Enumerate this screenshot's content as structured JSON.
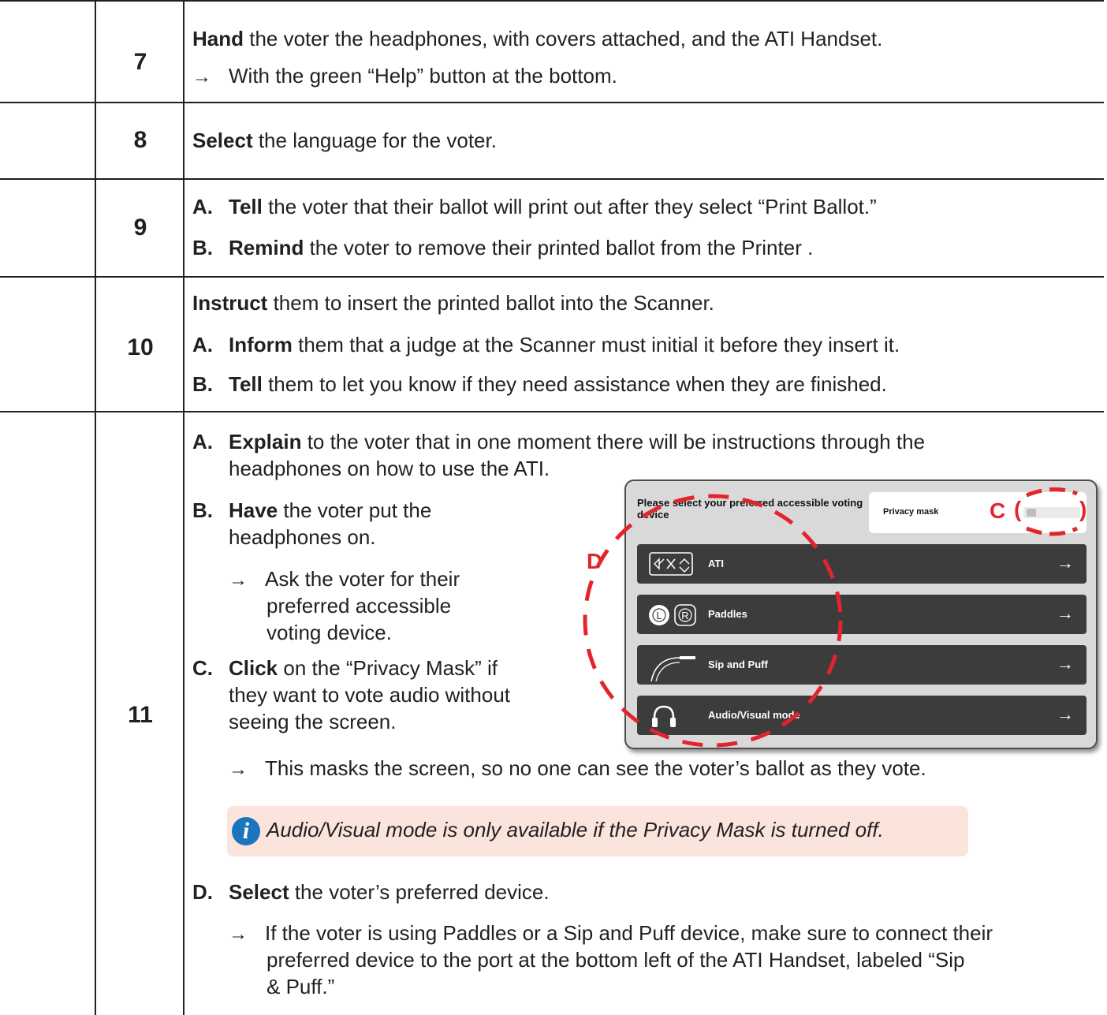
{
  "rows": [
    {
      "number": "7",
      "line1_bold": "Hand",
      "line1_rest": " the voter the headphones, with covers attached, and the ATI Handset.",
      "line2_arrow": "→",
      "line2": "With the green “Help” button at the bottom."
    },
    {
      "number": "8",
      "line1_bold": "Select",
      "line1_rest": " the language for the voter."
    },
    {
      "number": "9",
      "a_label": "A.",
      "a_bold": "Tell",
      "a_rest": " the voter that their ballot will print out after they select “Print Ballot.”",
      "b_label": "B.",
      "b_bold": "Remind",
      "b_rest": " the voter to remove their printed ballot from the Printer ."
    },
    {
      "number": "10",
      "intro_bold": "Instruct",
      "intro_rest": " them to insert the printed ballot into the Scanner.",
      "a_label": "A.",
      "a_bold": "Inform",
      "a_rest": " them that a judge at the Scanner must initial it before they insert it.",
      "b_label": "B.",
      "b_bold": "Tell",
      "b_rest": " them to let you know if they need assistance when they are finished."
    },
    {
      "number": "11",
      "a_label": "A.",
      "a_bold": "Explain",
      "a_rest": " to the voter that in one moment there will be instructions through the",
      "a_line2": "headphones on how to use the ATI.",
      "b_label": "B.",
      "b_bold": "Have",
      "b_rest": " the voter put the",
      "b_line2": "headphones on.",
      "b_sub_arrow": "→",
      "b_sub_line1": "Ask the voter for their",
      "b_sub_line2": "preferred accessible",
      "b_sub_line3": "voting device.",
      "c_label": "C.",
      "c_bold": "Click",
      "c_rest": " on the “Privacy Mask” if",
      "c_line2": "they want to vote audio without",
      "c_line3": "seeing the screen.",
      "c_sub_arrow": "→",
      "c_sub": "This masks the screen, so no one can see the voter’s ballot as they vote.",
      "note": "Audio/Visual mode is only available if the Privacy Mask is turned off.",
      "note_icon": "i",
      "d_label": "D.",
      "d_bold": "Select",
      "d_rest": " the voter’s preferred device.",
      "d_sub_arrow": "→",
      "d_sub_line1": "If the voter is using Paddles or a Sip and Puff device, make sure to connect their",
      "d_sub_line2": "preferred device to the port at the bottom left of the ATI Handset, labeled “Sip",
      "d_sub_line3": "& Puff.”"
    }
  ],
  "screen": {
    "title": "Please select your preferred accessible voting device",
    "privacy_mask_label": "Privacy mask",
    "devices": [
      {
        "label": "ATI",
        "icon": "ati-handset-icon"
      },
      {
        "label": "Paddles",
        "icon": "paddles-icon"
      },
      {
        "label": "Sip and Puff",
        "icon": "sip-puff-icon"
      },
      {
        "label": "Audio/Visual mode",
        "icon": "headphones-icon"
      }
    ],
    "arrow": "→",
    "marker_c": "C",
    "marker_c_open": "(",
    "marker_c_close": ")",
    "marker_d": "D",
    "paddles_left_letter": "L",
    "paddles_right_letter": "R",
    "accent_color": "#e3242b"
  }
}
